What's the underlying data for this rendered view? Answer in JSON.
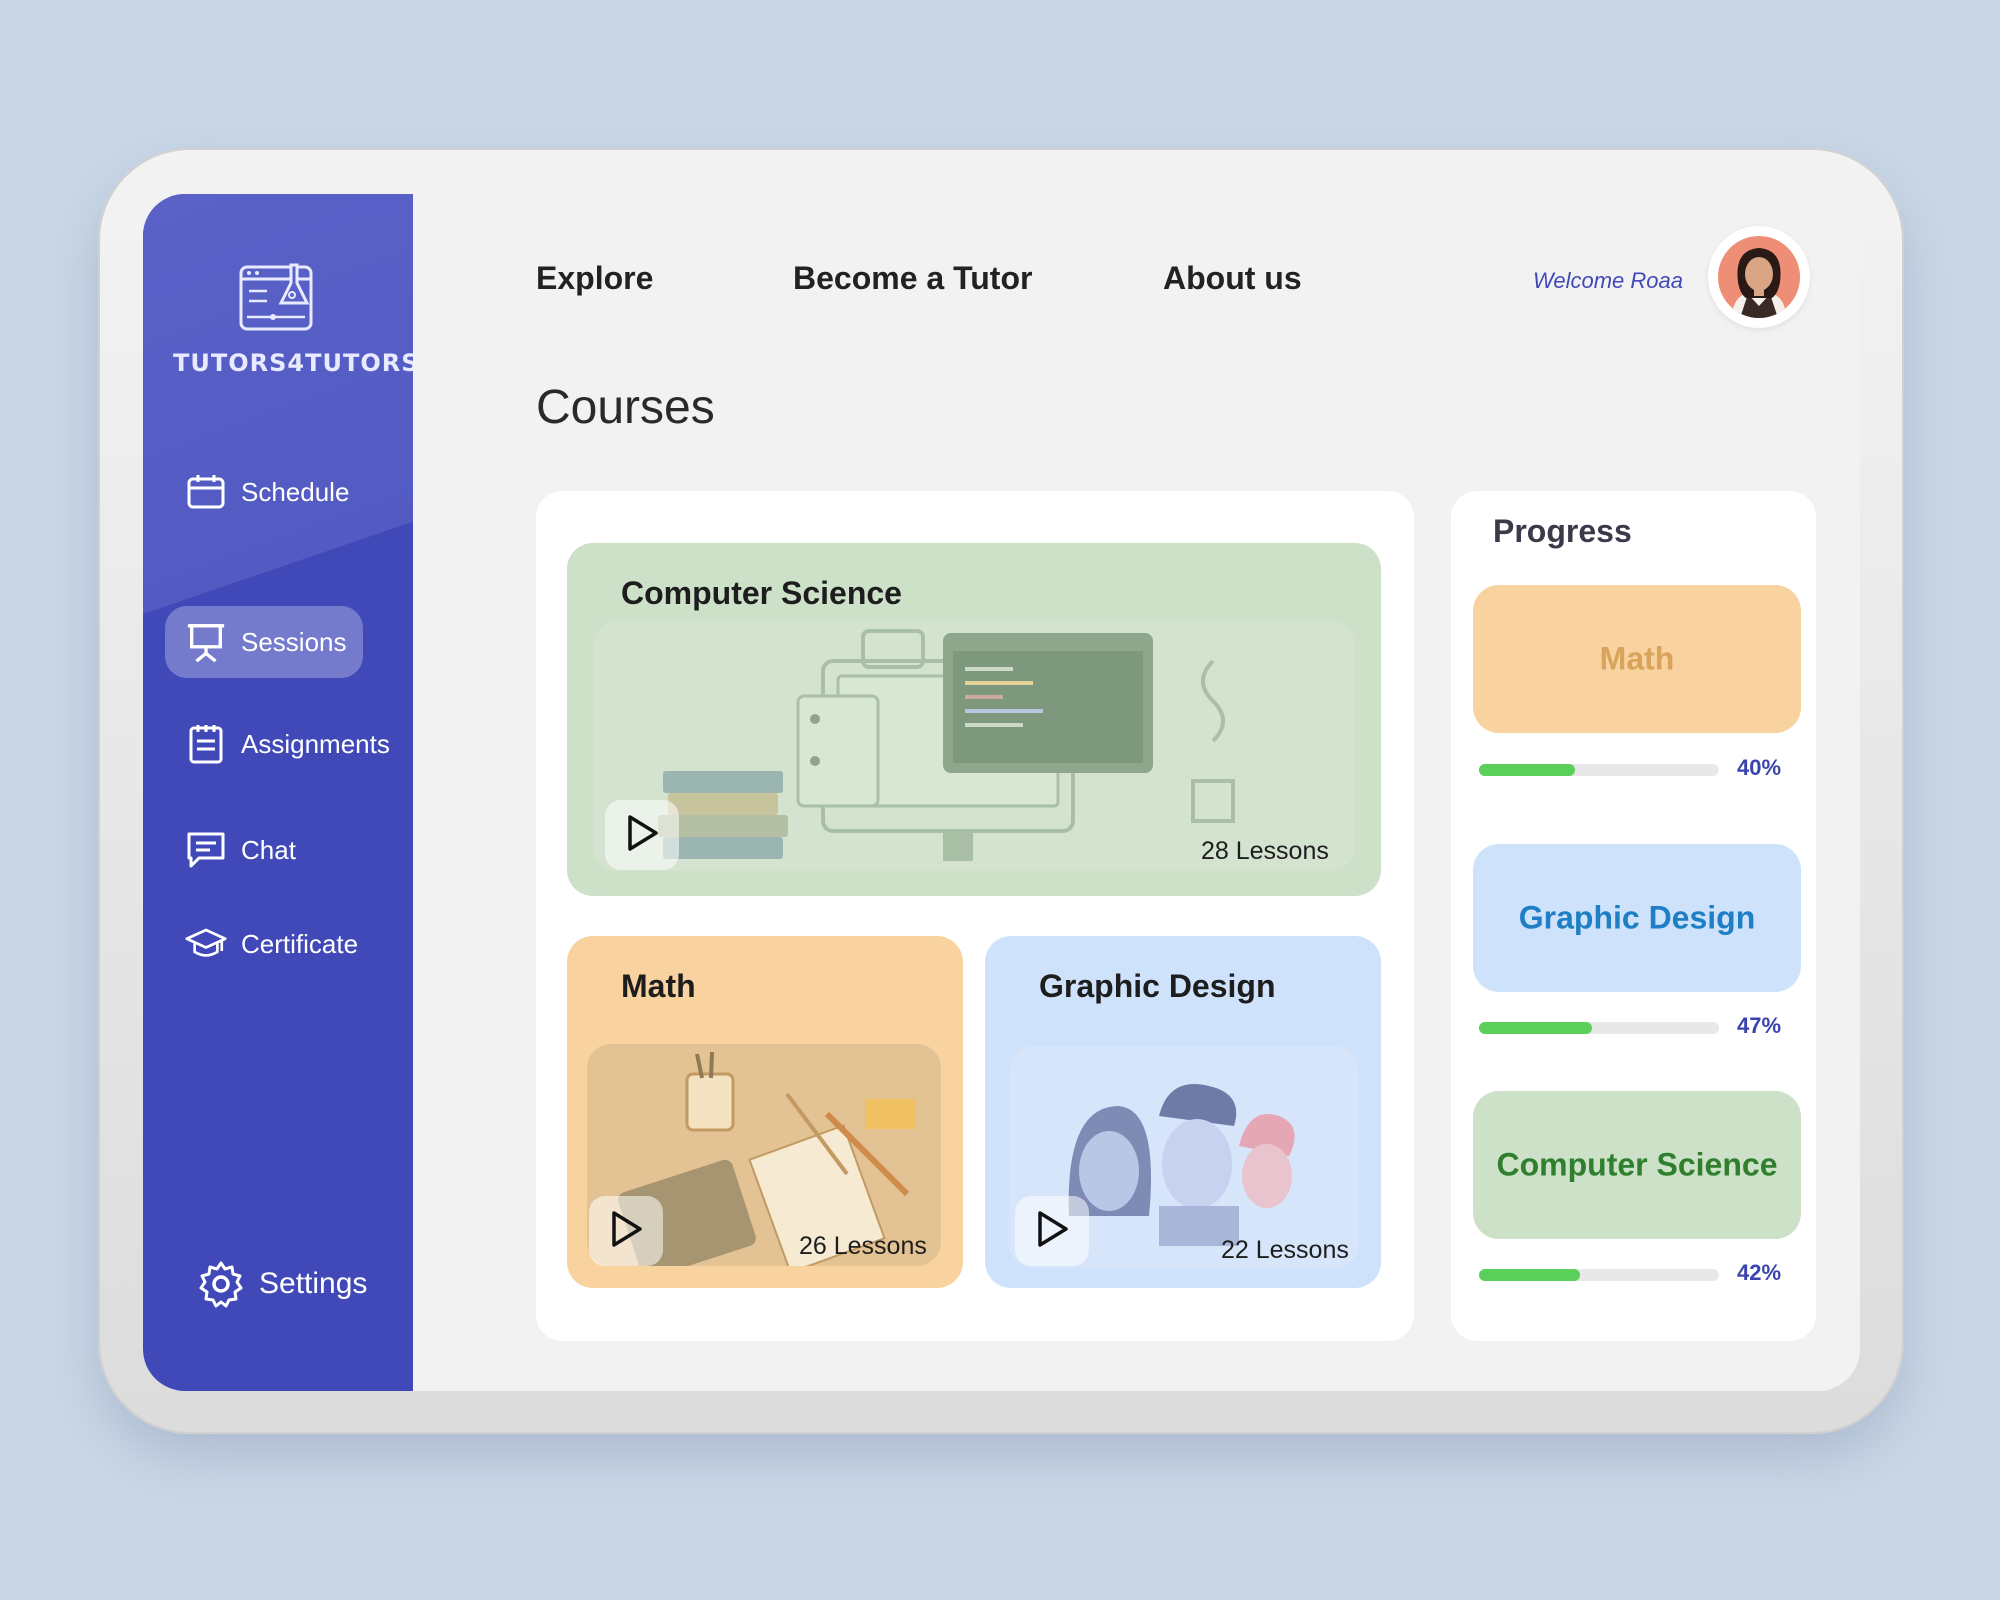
{
  "brand": {
    "name": "TUTORS4TUTORS"
  },
  "sidebar": {
    "items": [
      {
        "label": "Schedule",
        "icon": "calendar-icon",
        "active": false
      },
      {
        "label": "Sessions",
        "icon": "presentation-board-icon",
        "active": true
      },
      {
        "label": "Assignments",
        "icon": "clipboard-list-icon",
        "active": false
      },
      {
        "label": "Chat",
        "icon": "chat-icon",
        "active": false
      },
      {
        "label": "Certificate",
        "icon": "graduation-cap-icon",
        "active": false
      }
    ],
    "settings_label": "Settings"
  },
  "topnav": {
    "explore": "Explore",
    "become_tutor": "Become a Tutor",
    "about": "About us"
  },
  "user": {
    "welcome": "Welcome Roaa"
  },
  "page": {
    "title": "Courses"
  },
  "courses": [
    {
      "title": "Computer Science",
      "lessons": "28 Lessons",
      "color": "#cde0c8"
    },
    {
      "title": "Math",
      "lessons": "26 Lessons",
      "color": "#f8d29f"
    },
    {
      "title": "Graphic Design",
      "lessons": "22 Lessons",
      "color": "#cfe2fb"
    }
  ],
  "progress": {
    "title": "Progress",
    "items": [
      {
        "label": "Math",
        "percent_text": "40%",
        "value": 0.4,
        "bg": "#f8d29f",
        "text_color": "#d9a35b"
      },
      {
        "label": "Graphic Design",
        "percent_text": "47%",
        "value": 0.47,
        "bg": "#cfe2fb",
        "text_color": "#1e7fc4"
      },
      {
        "label": "Computer Science",
        "percent_text": "42%",
        "value": 0.42,
        "bg": "#cde0c8",
        "text_color": "#2f7f2f"
      }
    ]
  },
  "colors": {
    "sidebar": "#4149b9",
    "accent": "#4149b9",
    "progress_fill": "#5ad05a"
  }
}
